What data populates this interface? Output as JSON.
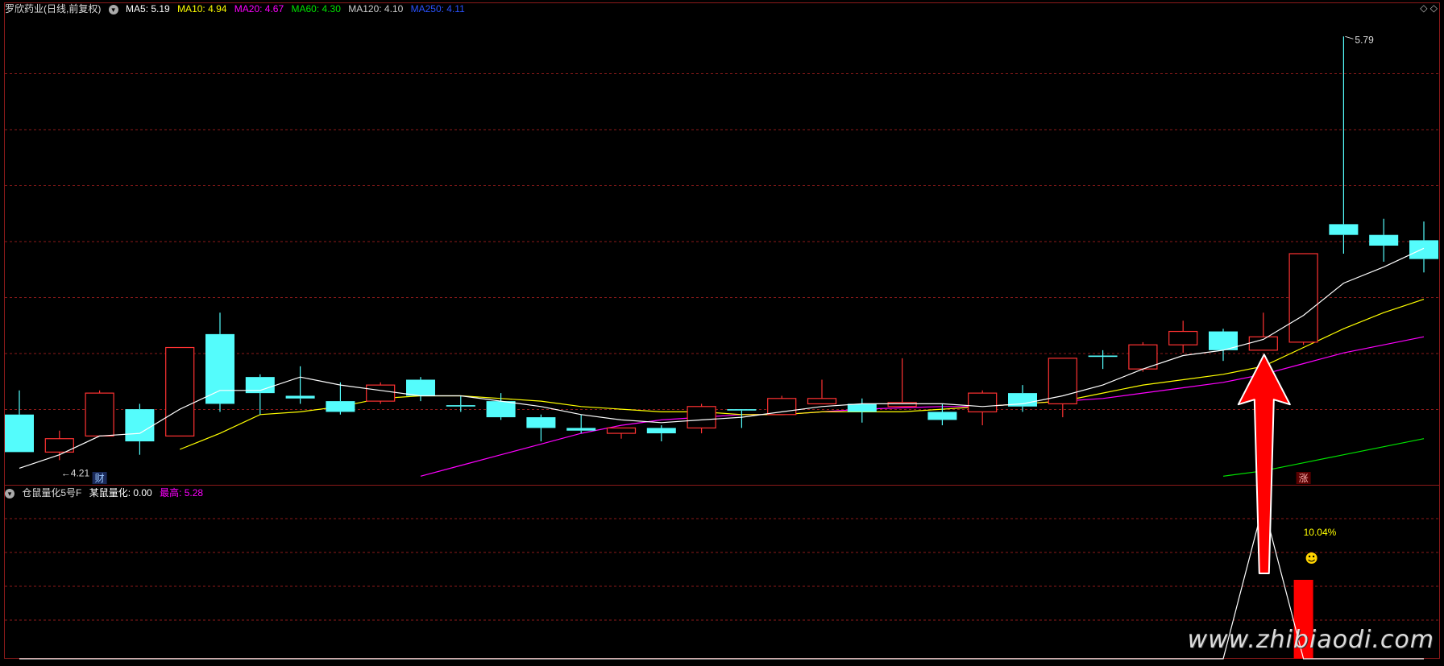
{
  "colors": {
    "up": "#ff3232",
    "down": "#54fcfc",
    "grid": "#8b1a1a",
    "ma5": "#ffffff",
    "ma10": "#ffff00",
    "ma20": "#ff00ff",
    "ma60": "#00e400",
    "ma120": "#cccccc",
    "ma250": "#2a52ff",
    "sub_line": "#ffffff",
    "sub_bar": "#ff0000",
    "arrow": "#ff0000"
  },
  "header": {
    "title": "罗欣药业(日线,前复权)",
    "ma5": "MA5: 5.19",
    "ma10": "MA10: 4.94",
    "ma20": "MA20: 4.67",
    "ma60": "MA60: 4.30",
    "ma120": "MA120: 4.10",
    "ma250": "MA250: 4.11",
    "icons": "◇ ◇"
  },
  "sub_header": {
    "title": "仓鼠量化5号F",
    "line_value": "某鼠量化: 0.00",
    "max_value": "最高: 5.28"
  },
  "annotations": {
    "high_label": "5.79",
    "low_label": "4.21",
    "cai_tag": "财",
    "zhang_tag": "涨",
    "pct_label": "10.04%",
    "smile_icon": "smiley-icon"
  },
  "watermark": "www.zhibiaodi.com",
  "chart_data": {
    "type": "candlestick",
    "price_range": [
      4.13,
      5.86
    ],
    "sub_range": [
      0,
      5.4
    ],
    "candles": [
      {
        "o": 4.38,
        "c": 4.24,
        "h": 4.47,
        "l": 4.24
      },
      {
        "o": 4.24,
        "c": 4.29,
        "h": 4.32,
        "l": 4.21
      },
      {
        "o": 4.3,
        "c": 4.46,
        "h": 4.47,
        "l": 4.3
      },
      {
        "o": 4.4,
        "c": 4.28,
        "h": 4.42,
        "l": 4.23
      },
      {
        "o": 4.3,
        "c": 4.63,
        "h": 4.63,
        "l": 4.3
      },
      {
        "o": 4.68,
        "c": 4.42,
        "h": 4.76,
        "l": 4.39
      },
      {
        "o": 4.52,
        "c": 4.46,
        "h": 4.53,
        "l": 4.38
      },
      {
        "o": 4.45,
        "c": 4.44,
        "h": 4.56,
        "l": 4.42
      },
      {
        "o": 4.43,
        "c": 4.39,
        "h": 4.5,
        "l": 4.38
      },
      {
        "o": 4.43,
        "c": 4.49,
        "h": 4.5,
        "l": 4.42
      },
      {
        "o": 4.51,
        "c": 4.45,
        "h": 4.52,
        "l": 4.43
      },
      {
        "o": 4.415,
        "c": 4.41,
        "h": 4.45,
        "l": 4.39
      },
      {
        "o": 4.43,
        "c": 4.37,
        "h": 4.46,
        "l": 4.36
      },
      {
        "o": 4.37,
        "c": 4.33,
        "h": 4.38,
        "l": 4.28
      },
      {
        "o": 4.33,
        "c": 4.32,
        "h": 4.38,
        "l": 4.31
      },
      {
        "o": 4.31,
        "c": 4.33,
        "h": 4.33,
        "l": 4.29
      },
      {
        "o": 4.33,
        "c": 4.31,
        "h": 4.34,
        "l": 4.28
      },
      {
        "o": 4.33,
        "c": 4.41,
        "h": 4.42,
        "l": 4.31
      },
      {
        "o": 4.4,
        "c": 4.395,
        "h": 4.4,
        "l": 4.33
      },
      {
        "o": 4.38,
        "c": 4.44,
        "h": 4.45,
        "l": 4.38
      },
      {
        "o": 4.42,
        "c": 4.44,
        "h": 4.51,
        "l": 4.42
      },
      {
        "o": 4.42,
        "c": 4.39,
        "h": 4.44,
        "l": 4.35
      },
      {
        "o": 4.41,
        "c": 4.425,
        "h": 4.59,
        "l": 4.41
      },
      {
        "o": 4.39,
        "c": 4.36,
        "h": 4.42,
        "l": 4.34
      },
      {
        "o": 4.39,
        "c": 4.46,
        "h": 4.47,
        "l": 4.34
      },
      {
        "o": 4.46,
        "c": 4.41,
        "h": 4.49,
        "l": 4.39
      },
      {
        "o": 4.42,
        "c": 4.59,
        "h": 4.59,
        "l": 4.37
      },
      {
        "o": 4.6,
        "c": 4.595,
        "h": 4.62,
        "l": 4.55
      },
      {
        "o": 4.55,
        "c": 4.64,
        "h": 4.65,
        "l": 4.54
      },
      {
        "o": 4.64,
        "c": 4.69,
        "h": 4.73,
        "l": 4.61
      },
      {
        "o": 4.69,
        "c": 4.62,
        "h": 4.7,
        "l": 4.58
      },
      {
        "o": 4.62,
        "c": 4.67,
        "h": 4.76,
        "l": 4.62
      },
      {
        "o": 4.65,
        "c": 4.98,
        "h": 4.98,
        "l": 4.64
      },
      {
        "o": 5.09,
        "c": 5.05,
        "h": 5.79,
        "l": 4.98
      },
      {
        "o": 5.05,
        "c": 5.01,
        "h": 5.11,
        "l": 4.95
      },
      {
        "o": 5.03,
        "c": 4.96,
        "h": 5.1,
        "l": 4.91
      }
    ],
    "ma5": [
      4.18,
      4.23,
      4.3,
      4.31,
      4.4,
      4.47,
      4.47,
      4.52,
      4.49,
      4.47,
      4.45,
      4.45,
      4.43,
      4.41,
      4.38,
      4.36,
      4.35,
      4.36,
      4.37,
      4.39,
      4.41,
      4.42,
      4.42,
      4.42,
      4.41,
      4.42,
      4.45,
      4.49,
      4.55,
      4.6,
      4.62,
      4.66,
      4.75,
      4.87,
      4.93,
      5.0
    ],
    "ma10": [
      null,
      null,
      null,
      null,
      4.25,
      4.31,
      4.38,
      4.39,
      4.41,
      4.44,
      4.45,
      4.45,
      4.44,
      4.43,
      4.41,
      4.4,
      4.39,
      4.39,
      4.38,
      4.38,
      4.39,
      4.39,
      4.39,
      4.4,
      4.41,
      4.42,
      4.43,
      4.46,
      4.49,
      4.51,
      4.53,
      4.56,
      4.63,
      4.7,
      4.76,
      4.81
    ],
    "ma20": [
      null,
      null,
      null,
      null,
      null,
      null,
      null,
      null,
      null,
      null,
      4.15,
      4.19,
      4.23,
      4.27,
      4.31,
      4.34,
      4.36,
      4.37,
      4.38,
      4.38,
      4.39,
      4.4,
      4.405,
      4.41,
      4.41,
      4.42,
      4.43,
      4.44,
      4.46,
      4.48,
      4.5,
      4.53,
      4.57,
      4.61,
      4.64,
      4.67
    ],
    "ma60": [
      null,
      null,
      null,
      null,
      null,
      null,
      null,
      null,
      null,
      null,
      null,
      null,
      null,
      null,
      null,
      null,
      null,
      null,
      null,
      null,
      null,
      null,
      null,
      null,
      null,
      null,
      null,
      null,
      null,
      null,
      4.15,
      4.17,
      4.2,
      4.23,
      4.26,
      4.29
    ],
    "sub_line": [
      0,
      0,
      0,
      0,
      0,
      0,
      0,
      0,
      0,
      0,
      0,
      0,
      0,
      0,
      0,
      0,
      0,
      0,
      0,
      0,
      0,
      0,
      0,
      0,
      0,
      0,
      0,
      0,
      0,
      0,
      0,
      5.28,
      0,
      0,
      0,
      0
    ],
    "sub_bar": {
      "index": 32,
      "value": 2.7
    }
  }
}
